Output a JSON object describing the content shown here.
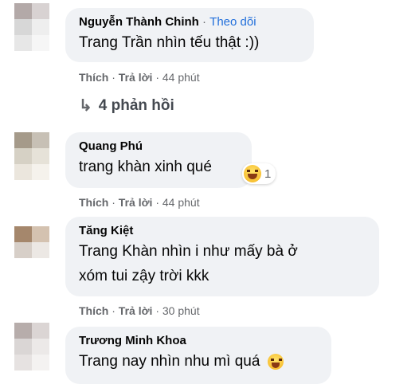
{
  "comments": [
    {
      "author": "Nguyễn Thành Chinh",
      "follow_label": "Theo dõi",
      "text": "Trang Trần nhìn tếu thật :))",
      "like": "Thích",
      "reply": "Trả lời",
      "time": "44 phút",
      "replies_label": "4 phản hồi",
      "avatar_colors": [
        "#b3a9a8",
        "#d8d2d2",
        "#d7d7d7",
        "#eeeeee",
        "#e7e7e7",
        "#f6f6f6"
      ]
    },
    {
      "author": "Quang Phú",
      "text": "trang khàn xinh qué",
      "reaction_count": "1",
      "reaction_icon": "laughing-emoji-icon",
      "like": "Thích",
      "reply": "Trả lời",
      "time": "44 phút",
      "avatar_colors": [
        "#a59a8a",
        "#c7c0b5",
        "#d6d1c5",
        "#e6e2d8",
        "#ebe6dd",
        "#f5f2ec"
      ]
    },
    {
      "author": "Tăng Kiệt",
      "text_line1": "Trang Khàn nhìn i như mấy bà ở",
      "text_line2": "xóm tui zậy trời kkk",
      "like": "Thích",
      "reply": "Trả lời",
      "time": "30 phút",
      "avatar_colors": [
        "#a5876c",
        "#d4c2b0",
        "#d7cfc8",
        "#ece8e4",
        "#ece6e1",
        "#f4f0ec"
      ]
    },
    {
      "author": "Trương Minh Khoa",
      "text": "Trang nay nhìn nhu mì quá",
      "inline_icon": "laughing-emoji-icon",
      "avatar_colors": [
        "#b7adab",
        "#dbd5d4",
        "#dad6d5",
        "#ece9e8",
        "#e6e2e1",
        "#f4f2f1"
      ]
    }
  ],
  "colors": {
    "bubble": "#f0f2f5",
    "follow": "#216fdb",
    "meta": "#65676b"
  }
}
